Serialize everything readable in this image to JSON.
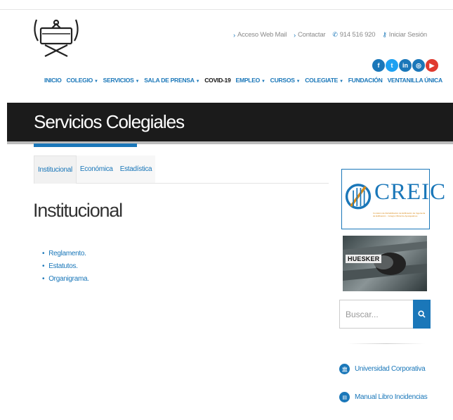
{
  "header": {
    "top_links": [
      {
        "icon": "chevron-right-icon",
        "glyph": "›",
        "label": "Acceso Web Mail"
      },
      {
        "icon": "chevron-right-icon",
        "glyph": "›",
        "label": "Contactar"
      },
      {
        "icon": "phone-icon",
        "glyph": "✆",
        "label": "914 516 920"
      },
      {
        "icon": "key-icon",
        "glyph": "⚷",
        "label": "Iniciar Sesión"
      }
    ],
    "social": [
      {
        "name": "facebook-icon",
        "glyph": "f",
        "color": "#1a77b9"
      },
      {
        "name": "twitter-icon",
        "glyph": "t",
        "color": "#1da1f2"
      },
      {
        "name": "linkedin-icon",
        "glyph": "in",
        "color": "#1a77b9"
      },
      {
        "name": "instagram-icon",
        "glyph": "◎",
        "color": "#1a77b9"
      },
      {
        "name": "youtube-icon",
        "glyph": "▶",
        "color": "#e03a2f"
      }
    ],
    "nav": [
      {
        "label": "INICIO",
        "caret": false,
        "dark": false
      },
      {
        "label": "COLEGIO",
        "caret": true,
        "dark": false
      },
      {
        "label": "SERVICIOS",
        "caret": true,
        "dark": false
      },
      {
        "label": "SALA DE PRENSA",
        "caret": true,
        "dark": false
      },
      {
        "label": "COVID-19",
        "caret": false,
        "dark": true
      },
      {
        "label": "EMPLEO",
        "caret": true,
        "dark": false
      },
      {
        "label": "CURSOS",
        "caret": true,
        "dark": false
      },
      {
        "label": "COLEGIATE",
        "caret": true,
        "dark": false
      },
      {
        "label": "FUNDACIÓN",
        "caret": false,
        "dark": false
      },
      {
        "label": "VENTANILLA ÚNICA",
        "caret": false,
        "dark": false
      }
    ]
  },
  "banner": {
    "title": "Servicios Colegiales"
  },
  "tabs": [
    {
      "label": "Institucional",
      "active": true
    },
    {
      "label": "Económica",
      "active": false
    },
    {
      "label": "Estadística",
      "active": false
    }
  ],
  "content": {
    "title": "Institucional",
    "items": [
      "Reglamento.",
      "Estatutos.",
      "Organigrama."
    ]
  },
  "sidebar": {
    "creic": {
      "title": "CREIC",
      "subtitle": "Comisión de Rehabilitación de Edificación de Ingeniería de Edificación · Colegio Oficial de Aparejadores"
    },
    "huesker": {
      "label": "HUESKER"
    },
    "search": {
      "placeholder": "Buscar..."
    },
    "links": [
      {
        "icon": "university-icon",
        "glyph": "🏛",
        "label": "Universidad Corporativa"
      },
      {
        "icon": "book-icon",
        "glyph": "▤",
        "label": "Manual Libro Incidencias"
      }
    ]
  },
  "colors": {
    "accent": "#1a77b9",
    "banner": "#1b1b1b"
  }
}
